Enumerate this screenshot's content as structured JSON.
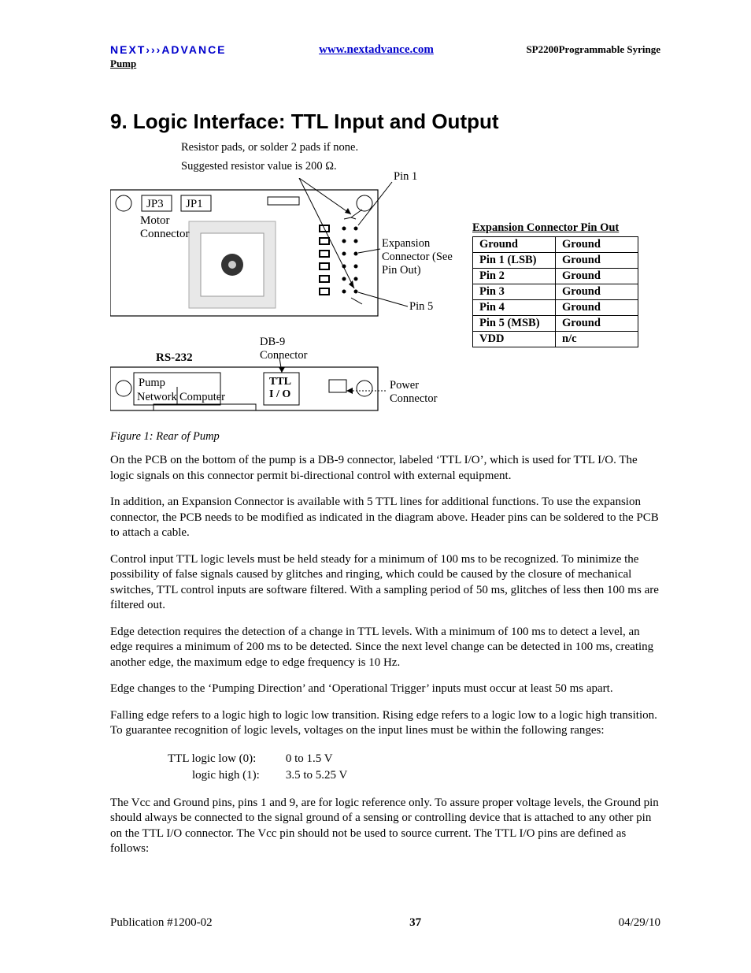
{
  "header": {
    "brand": "NEXT›››ADVANCE",
    "url": "www.nextadvance.com",
    "model": "SP2200Programmable Syringe",
    "sub": "Pump"
  },
  "section": {
    "number": "9.",
    "title": "Logic Interface:  TTL Input and Output"
  },
  "fig": {
    "note1": "Resistor pads, or solder 2 pads if none.",
    "note2": "Suggested resistor value is 200 Ω.",
    "pin1": "Pin 1",
    "pin5": "Pin 5",
    "jp3": "JP3",
    "jp1": "JP1",
    "motor": "Motor",
    "connector": "Connector",
    "expansion": "Expansion",
    "exp2": "Connector (See",
    "exp3": "Pin Out)",
    "rs232": "RS-232",
    "db9": "DB-9",
    "db9b": "Connector",
    "ttl": "TTL",
    "io": "I / O",
    "pump": "Pump",
    "network": "Network",
    "computer": "Computer",
    "power": "Power",
    "powerc": "Connector",
    "caption": "Figure 1: Rear of Pump"
  },
  "pinout": {
    "title": "Expansion Connector Pin Out",
    "rows": [
      {
        "a": "Ground",
        "b": "Ground"
      },
      {
        "a": "Pin 1 (LSB)",
        "b": "Ground"
      },
      {
        "a": "Pin 2",
        "b": "Ground"
      },
      {
        "a": "Pin 3",
        "b": "Ground"
      },
      {
        "a": "Pin 4",
        "b": "Ground"
      },
      {
        "a": "Pin 5 (MSB)",
        "b": "Ground"
      },
      {
        "a": "VDD",
        "b": "n/c"
      }
    ]
  },
  "body": {
    "p1": "On the PCB on the bottom of the pump is a DB-9 connector, labeled ‘TTL I/O’, which is used for TTL I/O. The logic signals on this connector permit bi-directional control with external equipment.",
    "p2": "In addition, an Expansion Connector is available with 5 TTL lines for additional functions.  To use the expansion connector, the PCB needs to be modified as indicated in the diagram above.  Header pins can be soldered to the PCB to attach a cable.",
    "p3": "Control input TTL logic levels must be held steady for a minimum of 100 ms to be recognized. To minimize the possibility of false signals caused by glitches and ringing, which could be caused by the closure of mechanical switches, TTL control inputs are software filtered.  With a sampling period of 50 ms, glitches of less then 100 ms are filtered out.",
    "p4": "Edge detection requires the detection of a change in TTL levels.  With a minimum of 100 ms to detect a level, an edge requires a minimum of 200 ms to be detected.  Since the next level change can be detected in 100 ms, creating another edge, the maximum edge to edge frequency is 10 Hz.",
    "p5": "Edge changes to the ‘Pumping Direction’ and ‘Operational Trigger’ inputs must occur at least 50 ms apart.",
    "p6": "Falling edge refers to a logic high to logic low transition.  Rising edge refers to a logic low to a logic high transition.  To guarantee recognition of logic levels, voltages on the input lines must be within the following ranges:",
    "p7": "The Vcc and Ground pins, pins 1 and 9, are for logic reference only.  To assure proper voltage levels, the Ground pin should always be connected to the signal ground of a sensing or controlling device that is attached to any other pin on the TTL I/O connector.  The Vcc pin should not be used to source current.  The TTL I/O pins are defined as follows:"
  },
  "levels": {
    "r1a": "TTL  logic low (0):",
    "r1b": "0 to 1.5 V",
    "r2a": "logic high (1):",
    "r2b": "3.5 to 5.25 V"
  },
  "footer": {
    "pub": "Publication #1200-02",
    "page": "37",
    "date": "04/29/10"
  }
}
